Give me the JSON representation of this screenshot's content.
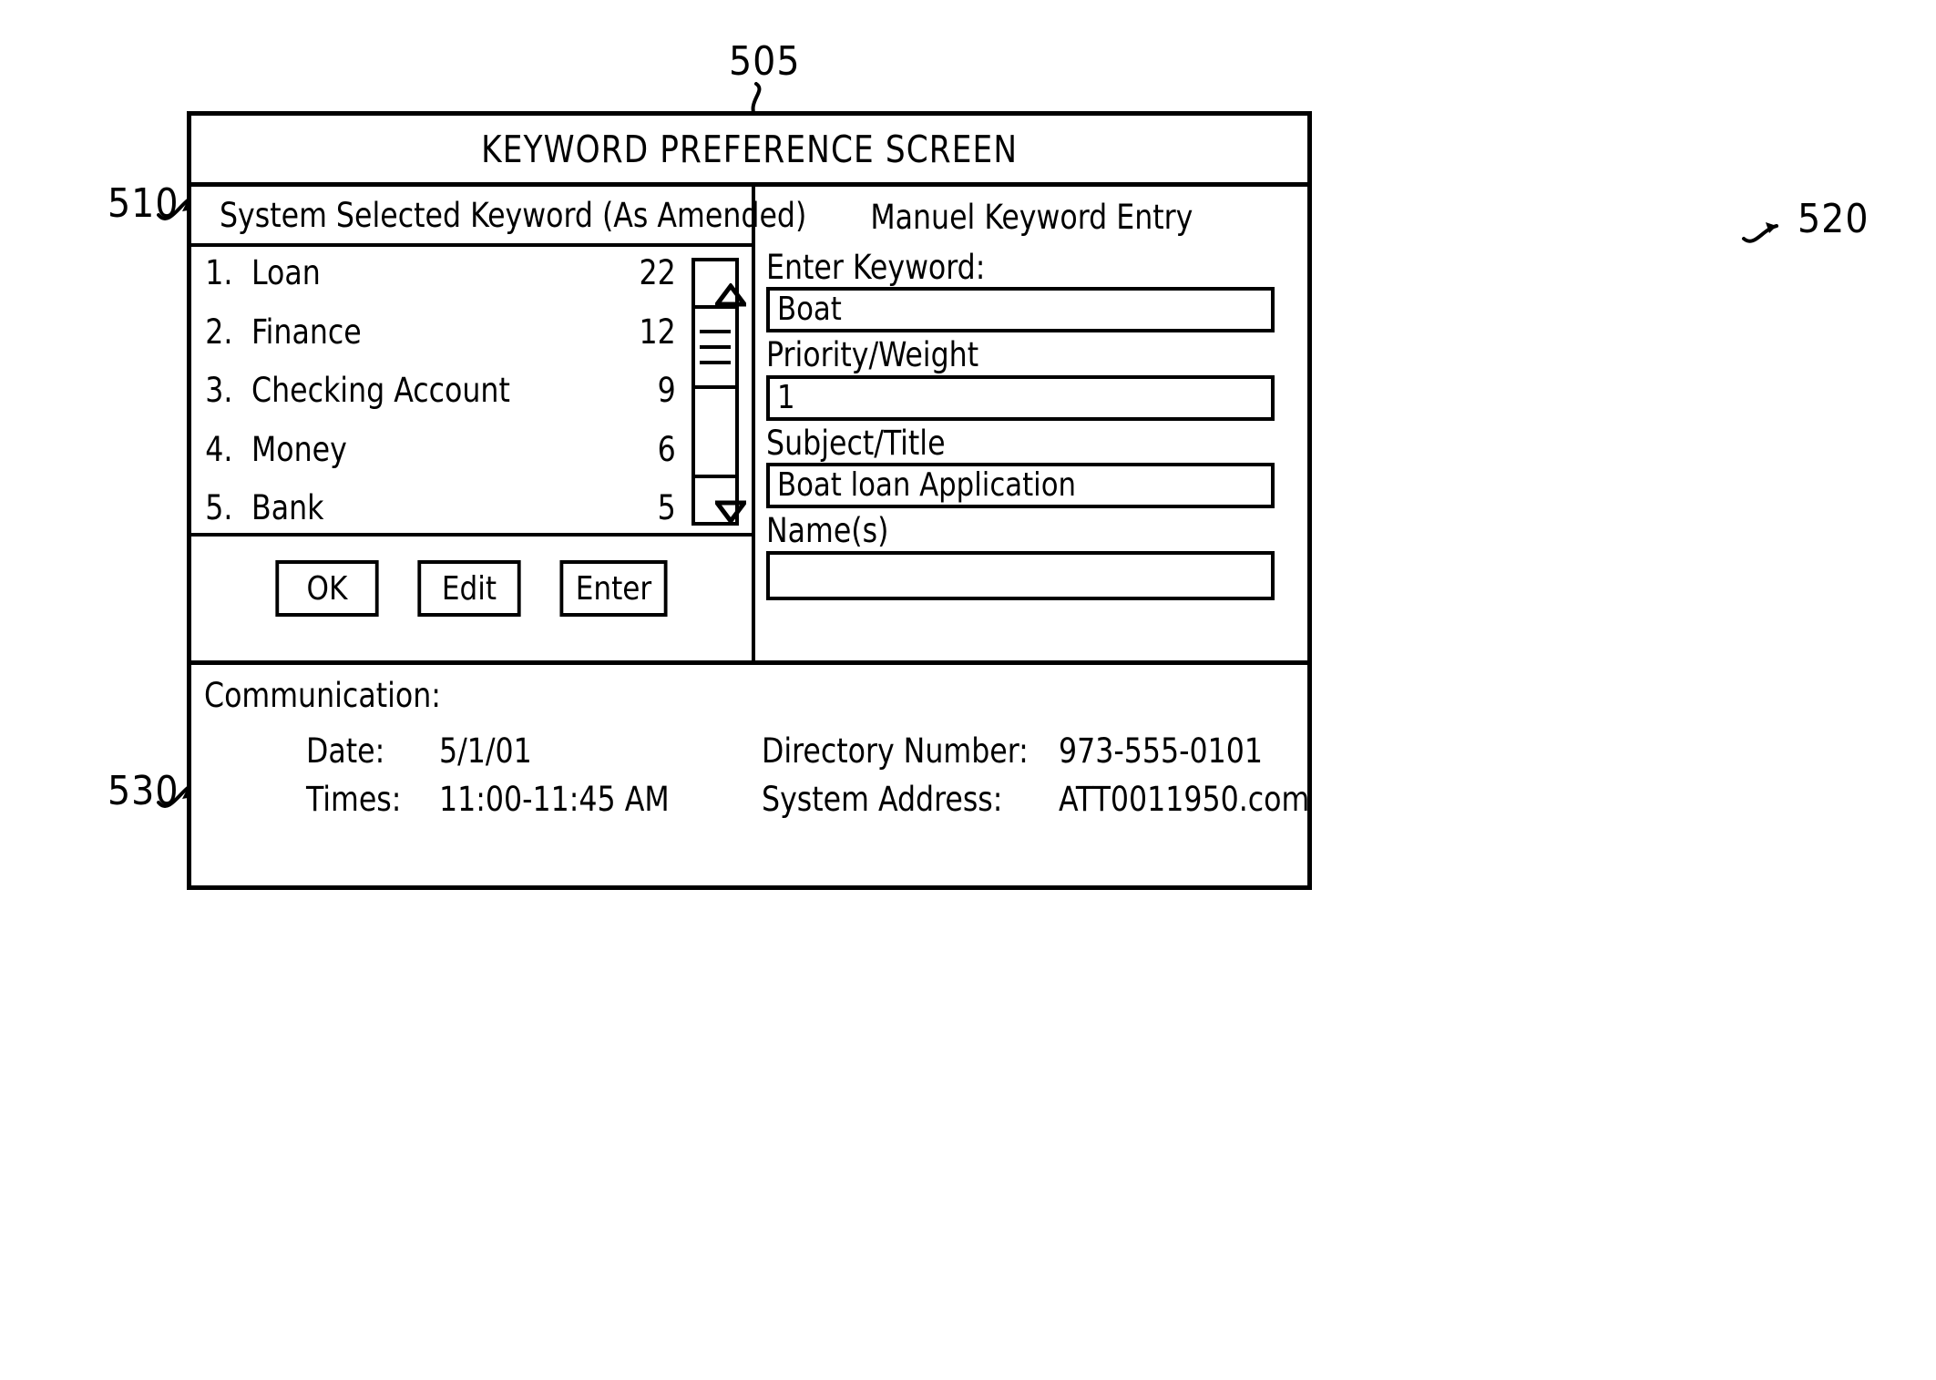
{
  "figure": {
    "callouts": [
      {
        "id": "505",
        "label": "505"
      },
      {
        "id": "510",
        "label": "510"
      },
      {
        "id": "520",
        "label": "520"
      },
      {
        "id": "530",
        "label": "530"
      }
    ]
  },
  "window": {
    "title": "KEYWORD PREFERENCE SCREEN"
  },
  "left_panel": {
    "header": "System Selected Keyword (As Amended)",
    "keywords": [
      {
        "index": "1.",
        "label": "Loan",
        "count": "22"
      },
      {
        "index": "2.",
        "label": "Finance",
        "count": "12"
      },
      {
        "index": "3.",
        "label": "Checking Account",
        "count": "9"
      },
      {
        "index": "4.",
        "label": "Money",
        "count": "6"
      },
      {
        "index": "5.",
        "label": "Bank",
        "count": "5"
      }
    ],
    "scrollbar": {
      "up_icon": "triangle-up-icon",
      "down_icon": "triangle-down-icon"
    },
    "buttons": [
      {
        "label": "OK"
      },
      {
        "label": "Edit"
      },
      {
        "label": "Enter"
      }
    ]
  },
  "right_panel": {
    "header": "Manuel Keyword Entry",
    "fields": [
      {
        "label": "Enter Keyword:",
        "value": "Boat"
      },
      {
        "label": "Priority/Weight",
        "value": "1"
      },
      {
        "label": "Subject/Title",
        "value": "Boat loan Application"
      },
      {
        "label": "Name(s)",
        "value": ""
      }
    ]
  },
  "communication": {
    "title": "Communication:",
    "left": [
      {
        "key": "Date:",
        "value": "5/1/01"
      },
      {
        "key": "Times:",
        "value": "11:00-11:45 AM"
      }
    ],
    "right": [
      {
        "key": "Directory Number:",
        "value": "973-555-0101"
      },
      {
        "key": "System Address:",
        "value": "ATT0011950.com"
      }
    ]
  }
}
